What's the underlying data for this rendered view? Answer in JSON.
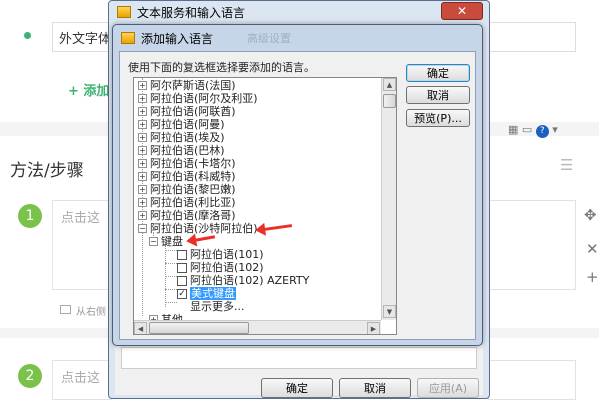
{
  "colors": {
    "accent_green": "#3cb371",
    "arrow_red": "#e8302a",
    "selection_blue": "#3399ff"
  },
  "background": {
    "input_value": "外文字体",
    "add_label": "+ 添加",
    "section_title": "方法/步骤",
    "step1_number": "1",
    "step1_placeholder": "点击这",
    "step1_hint": "从右侧",
    "step2_number": "2",
    "step2_placeholder": "点击这",
    "side_icons": [
      "move-icon",
      "close-icon",
      "plus-icon"
    ]
  },
  "outer_dialog": {
    "title": "文本服务和输入语言",
    "close": "✕",
    "buttons": {
      "ok": "确定",
      "cancel": "取消",
      "apply": "应用(A)"
    }
  },
  "dialog": {
    "title": "添加输入语言",
    "ghost_title": "高级设置",
    "instruction": "使用下面的复选框选择要添加的语言。",
    "buttons": {
      "ok": "确定",
      "cancel": "取消",
      "preview": "预览(P)..."
    }
  },
  "tree": {
    "languages": [
      "阿尔萨斯语(法国)",
      "阿拉伯语(阿尔及利亚)",
      "阿拉伯语(阿联酋)",
      "阿拉伯语(阿曼)",
      "阿拉伯语(埃及)",
      "阿拉伯语(巴林)",
      "阿拉伯语(卡塔尔)",
      "阿拉伯语(科威特)",
      "阿拉伯语(黎巴嫩)",
      "阿拉伯语(利比亚)",
      "阿拉伯语(摩洛哥)"
    ],
    "expanded_language": "阿拉伯语(沙特阿拉伯)",
    "keyboard_group": "键盘",
    "keyboards": [
      {
        "label": "阿拉伯语(101)",
        "checked": false
      },
      {
        "label": "阿拉伯语(102)",
        "checked": false
      },
      {
        "label": "阿拉伯语(102) AZERTY",
        "checked": false
      },
      {
        "label": "美式键盘",
        "checked": true
      }
    ],
    "show_more": "显示更多...",
    "other_group": "其他"
  }
}
